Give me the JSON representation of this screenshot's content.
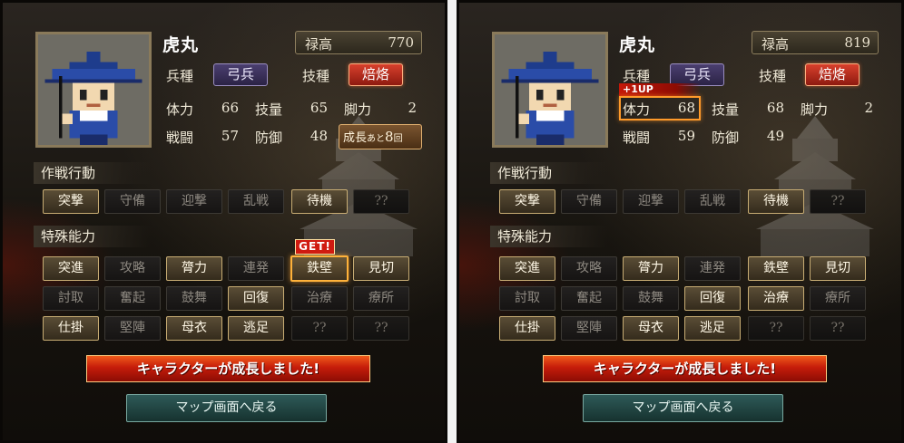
{
  "panels": [
    {
      "name": "虎丸",
      "stipend_label": "禄高",
      "stipend_value": "770",
      "unit_label": "兵種",
      "unit_value": "弓兵",
      "skill_label": "技種",
      "skill_value": "焙烙",
      "stats": {
        "hp_label": "体力",
        "hp": "66",
        "tech_label": "技量",
        "tech": "65",
        "leg_label": "脚力",
        "leg": "2",
        "atk_label": "戦闘",
        "atk": "57",
        "def_label": "防御",
        "def": "48"
      },
      "growth_label": "成長",
      "growth_ato": "あと",
      "growth_num": "8",
      "growth_unit": "回",
      "tactics_title": "作戦行動",
      "tactics": [
        "突撃",
        "守備",
        "迎撃",
        "乱戦",
        "待機",
        "??"
      ],
      "abilities_title": "特殊能力",
      "abilities_row1": [
        "突進",
        "攻略",
        "膂力",
        "連発",
        "鉄壁",
        "見切"
      ],
      "abilities_row2": [
        "討取",
        "奮起",
        "鼓舞",
        "回復",
        "治療",
        "療所"
      ],
      "abilities_row3": [
        "仕掛",
        "堅陣",
        "母衣",
        "逃足",
        "??",
        "??"
      ],
      "get_tag": "GET!",
      "banner": "キャラクターが成長しました!",
      "map_button": "マップ画面へ戻る"
    },
    {
      "name": "虎丸",
      "stipend_label": "禄高",
      "stipend_value": "819",
      "unit_label": "兵種",
      "unit_value": "弓兵",
      "skill_label": "技種",
      "skill_value": "焙烙",
      "stats": {
        "hp_label": "体力",
        "hp": "68",
        "tech_label": "技量",
        "tech": "68",
        "leg_label": "脚力",
        "leg": "2",
        "atk_label": "戦闘",
        "atk": "59",
        "def_label": "防御",
        "def": "49"
      },
      "oneup_tag": "+1UP",
      "tactics_title": "作戦行動",
      "tactics": [
        "突撃",
        "守備",
        "迎撃",
        "乱戦",
        "待機",
        "??"
      ],
      "abilities_title": "特殊能力",
      "abilities_row1": [
        "突進",
        "攻略",
        "膂力",
        "連発",
        "鉄壁",
        "見切"
      ],
      "abilities_row2": [
        "討取",
        "奮起",
        "鼓舞",
        "回復",
        "治療",
        "療所"
      ],
      "abilities_row3": [
        "仕掛",
        "堅陣",
        "母衣",
        "逃足",
        "??",
        "??"
      ],
      "banner": "キャラクターが成長しました!",
      "map_button": "マップ画面へ戻る"
    }
  ],
  "colors": {
    "accent_orange": "#ffb23a",
    "banner_red": "#c51c0a",
    "map_button_teal": "#2e5a58",
    "unit_badge_purple": "#4b3f70",
    "skill_badge_red": "#d8402c"
  }
}
